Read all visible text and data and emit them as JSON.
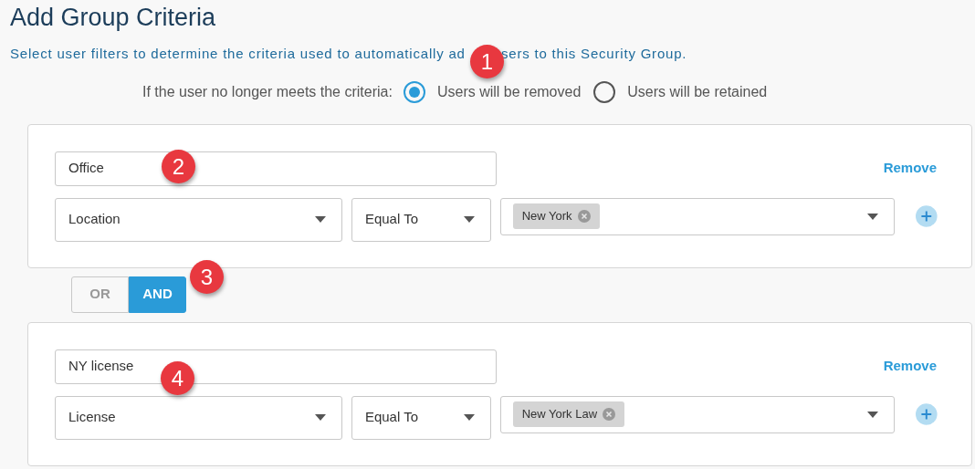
{
  "title": "Add Group Criteria",
  "subtitle_parts": [
    "Select user filters to determine the criteria used to automatically ad",
    "sers to this Security Group."
  ],
  "retention": {
    "label": "If the user no longer meets the criteria:",
    "options": [
      {
        "label": "Users will be removed",
        "selected": true
      },
      {
        "label": "Users will be retained",
        "selected": false
      }
    ]
  },
  "groups": [
    {
      "name": "Office",
      "remove": "Remove",
      "field": "Location",
      "operator": "Equal To",
      "values": [
        "New York"
      ]
    },
    {
      "name": "NY license",
      "remove": "Remove",
      "field": "License",
      "operator": "Equal To",
      "values": [
        "New York Law"
      ]
    }
  ],
  "connectors": [
    {
      "options": [
        {
          "label": "OR",
          "selected": false
        },
        {
          "label": "AND",
          "selected": true
        }
      ]
    }
  ],
  "callouts": [
    "1",
    "2",
    "3",
    "4"
  ]
}
